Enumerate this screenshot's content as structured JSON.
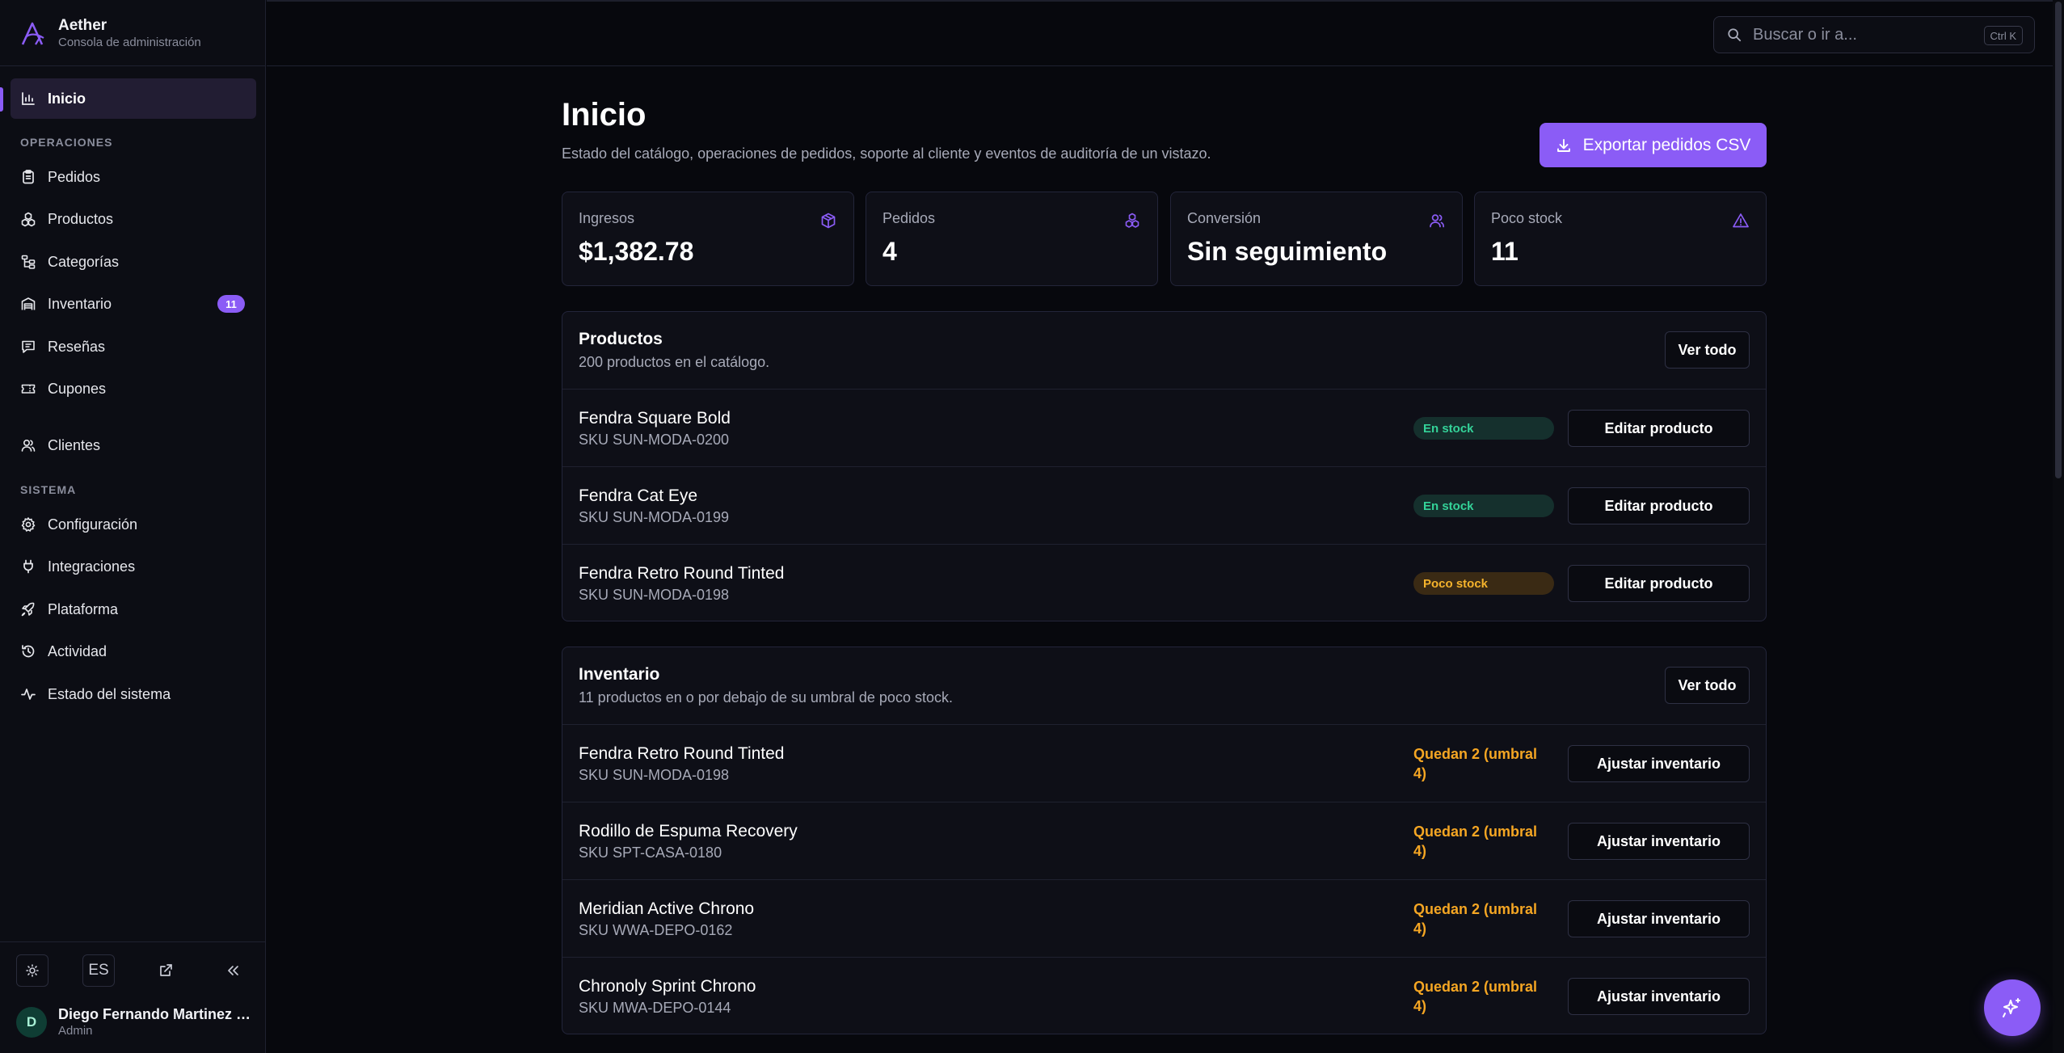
{
  "brand": {
    "name": "Aether",
    "subtitle": "Consola de administración"
  },
  "colors": {
    "accent": "#8b5cf6",
    "in_stock": "#34d399",
    "low_stock": "#f5b32c"
  },
  "sidebar": {
    "home": {
      "label": "Inicio",
      "icon": "bar-chart-icon",
      "active": true
    },
    "sections": [
      {
        "title": "OPERACIONES",
        "items": [
          {
            "label": "Pedidos",
            "icon": "clipboard-icon"
          },
          {
            "label": "Productos",
            "icon": "boxes-icon"
          },
          {
            "label": "Categorías",
            "icon": "tree-icon"
          },
          {
            "label": "Inventario",
            "icon": "warehouse-icon",
            "badge": "11"
          },
          {
            "label": "Reseñas",
            "icon": "message-icon"
          },
          {
            "label": "Cupones",
            "icon": "ticket-icon"
          }
        ]
      },
      {
        "title": "",
        "items": [
          {
            "label": "Clientes",
            "icon": "users-icon"
          }
        ]
      },
      {
        "title": "SISTEMA",
        "items": [
          {
            "label": "Configuración",
            "icon": "gear-icon"
          },
          {
            "label": "Integraciones",
            "icon": "plug-icon"
          },
          {
            "label": "Plataforma",
            "icon": "rocket-icon"
          },
          {
            "label": "Actividad",
            "icon": "history-icon"
          },
          {
            "label": "Estado del sistema",
            "icon": "activity-icon"
          }
        ]
      }
    ],
    "footer": {
      "language": "ES"
    },
    "user": {
      "initial": "D",
      "name": "Diego Fernando Martinez …",
      "role": "Admin"
    }
  },
  "search": {
    "placeholder": "Buscar o ir a...",
    "shortcut": "Ctrl K"
  },
  "page": {
    "title": "Inicio",
    "subtitle": "Estado del catálogo, operaciones de pedidos, soporte al cliente y eventos de auditoría de un vistazo.",
    "export_label": "Exportar pedidos CSV"
  },
  "stats": [
    {
      "label": "Ingresos",
      "value": "$1,382.78",
      "icon": "package-icon"
    },
    {
      "label": "Pedidos",
      "value": "4",
      "icon": "boxes-icon"
    },
    {
      "label": "Conversión",
      "value": "Sin seguimiento",
      "icon": "users-icon"
    },
    {
      "label": "Poco stock",
      "value": "11",
      "icon": "alert-triangle-icon"
    }
  ],
  "products_card": {
    "title": "Productos",
    "subtitle": "200 productos en el catálogo.",
    "view_all": "Ver todo",
    "rows": [
      {
        "name": "Fendra Square Bold",
        "sku": "SKU SUN-MODA-0200",
        "status": "En stock",
        "status_kind": "in-stock",
        "action": "Editar producto"
      },
      {
        "name": "Fendra Cat Eye",
        "sku": "SKU SUN-MODA-0199",
        "status": "En stock",
        "status_kind": "in-stock",
        "action": "Editar producto"
      },
      {
        "name": "Fendra Retro Round Tinted",
        "sku": "SKU SUN-MODA-0198",
        "status": "Poco stock",
        "status_kind": "low-stock",
        "action": "Editar producto"
      }
    ]
  },
  "inventory_card": {
    "title": "Inventario",
    "subtitle": "11 productos en o por debajo de su umbral de poco stock.",
    "view_all": "Ver todo",
    "rows": [
      {
        "name": "Fendra Retro Round Tinted",
        "sku": "SKU SUN-MODA-0198",
        "remaining": "Quedan 2 (umbral 4)",
        "action": "Ajustar inventario"
      },
      {
        "name": "Rodillo de Espuma Recovery",
        "sku": "SKU SPT-CASA-0180",
        "remaining": "Quedan 2 (umbral 4)",
        "action": "Ajustar inventario"
      },
      {
        "name": "Meridian Active Chrono",
        "sku": "SKU WWA-DEPO-0162",
        "remaining": "Quedan 2 (umbral 4)",
        "action": "Ajustar inventario"
      },
      {
        "name": "Chronoly Sprint Chrono",
        "sku": "SKU MWA-DEPO-0144",
        "remaining": "Quedan 2 (umbral 4)",
        "action": "Ajustar inventario"
      }
    ]
  }
}
